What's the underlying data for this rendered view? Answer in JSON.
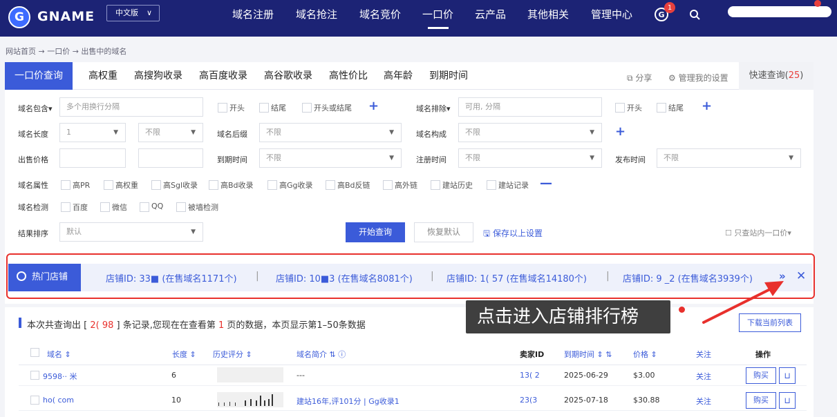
{
  "brand": {
    "logo_letter": "G",
    "name": "GNAME",
    "lang": "中文版",
    "lang_chevron": "∨"
  },
  "nav": [
    "域名注册",
    "域名抢注",
    "域名竞价",
    "一口价",
    "云产品",
    "其他相关",
    "管理中心"
  ],
  "notif": {
    "icon": "G",
    "count": "1"
  },
  "breadcrumb": "网站首页  →  一口价  →  出售中的域名",
  "tabs": [
    "一口价查询",
    "高权重",
    "高搜狗收录",
    "高百度收录",
    "高谷歌收录",
    "高性价比",
    "高年龄",
    "到期时间"
  ],
  "tools": {
    "share": "分享",
    "settings": "管理我的设置",
    "quick": "快速查询(",
    "quick_count": "25",
    "quick_end": ")"
  },
  "filters": {
    "contains_label": "域名包含▾",
    "contains_placeholder": "多个用换行分隔",
    "opt_start": "开头",
    "opt_end": "结尾",
    "opt_start_or_end": "开头或结尾",
    "exclude_label": "域名排除▾",
    "exclude_placeholder": "可用, 分隔",
    "length_label": "域名长度",
    "length_min": "1",
    "length_max": "不限",
    "suffix_label": "域名后缀",
    "suffix_value": "不限",
    "compose_label": "域名构成",
    "compose_value": "不限",
    "price_label": "出售价格",
    "expire_label": "到期时间",
    "expire_value": "不限",
    "reg_label": "注册时间",
    "reg_value": "不限",
    "publish_label": "发布时间",
    "publish_value": "不限",
    "attr_label": "域名属性",
    "attrs": [
      "高PR",
      "高权重",
      "高Sgl收录",
      "高Bd收录",
      "高Gg收录",
      "高Bd反链",
      "高外链",
      "建站历史",
      "建站记录"
    ],
    "detect_label": "域名检测",
    "detects": [
      "百度",
      "微信",
      "QQ",
      "被墙检测"
    ],
    "sort_label": "结果排序",
    "sort_value": "默认",
    "search_btn": "开始查询",
    "reset_btn": "恢复默认",
    "save": "保存以上设置",
    "only_shop": "只查站内一口价▾"
  },
  "hot_shops": {
    "label": "热门店铺",
    "shops": [
      "店铺ID: 33■ (在售域名1171个)",
      "店铺ID: 10■3 (在售域名8081个)",
      "店铺ID: 1(  57 (在售域名14180个)",
      "店铺ID: 9 _2 (在售域名3939个)"
    ],
    "more": "»",
    "close": "✕"
  },
  "tooltip": "点击进入店铺排行榜",
  "result": {
    "prefix": "本次共查询出 [ ",
    "count": "2(  98",
    "middle": " ] 条记录,您现在在查看第 ",
    "page": "1",
    "suffix": " 页的数据，本页显示第1–50条数据",
    "download": "下载当前列表"
  },
  "table": {
    "headers": {
      "name": "域名 ⇕",
      "length": "长度 ⇕",
      "score": "历史评分 ⇕",
      "intro": "域名简介 ⇅ ⓘ",
      "seller": "卖家ID",
      "expire": "到期时间 ⇕ ⇅",
      "price": "价格 ⇕",
      "follow": "关注",
      "action": "操作"
    },
    "rows": [
      {
        "name": "9598·· 米",
        "length": "6",
        "intro": "---",
        "seller": "13(  2",
        "expire": "2025-06-29",
        "price": "$3.00",
        "follow": "关注",
        "buy": "购买",
        "cart": "🛒"
      },
      {
        "name": "ho(        com",
        "length": "10",
        "intro": "建站16年,评101分 | Gg收录1",
        "seller": "23(3",
        "expire": "2025-07-18",
        "price": "$30.88",
        "follow": "关注",
        "buy": "购买",
        "cart": "🛒"
      }
    ]
  }
}
